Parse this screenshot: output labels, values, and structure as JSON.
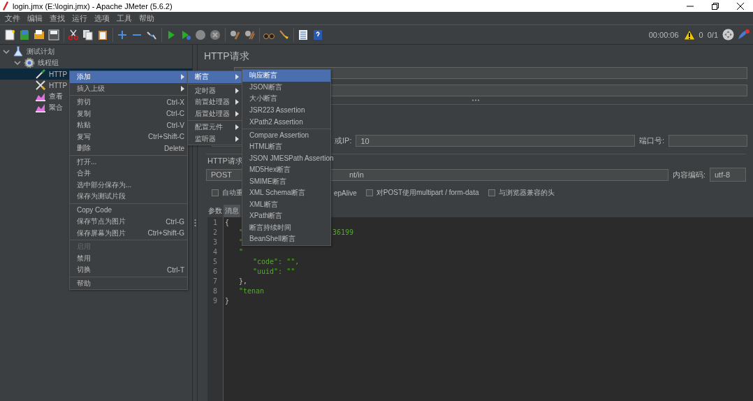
{
  "window": {
    "title": "login.jmx (E:\\login.jmx) - Apache JMeter (5.6.2)"
  },
  "menu_bar": [
    "文件",
    "编辑",
    "查找",
    "运行",
    "选项",
    "工具",
    "帮助"
  ],
  "toolbar": {
    "timer": "00:00:06",
    "warnings": "0",
    "threads": "0/1"
  },
  "tree": [
    {
      "label": "测试计划",
      "kind": "flask",
      "expanded": true,
      "selected": false,
      "children": [
        {
          "label": "线程组",
          "kind": "gear",
          "expanded": true,
          "selected": false,
          "children": [
            {
              "label": "HTTP",
              "kind": "pipette",
              "selected": true
            },
            {
              "label": "HTTP",
              "kind": "tools",
              "selected": false
            },
            {
              "label": "查看",
              "kind": "chart",
              "selected": false
            },
            {
              "label": "聚合",
              "kind": "chart",
              "selected": false
            }
          ]
        }
      ]
    }
  ],
  "panel": {
    "title": "HTTP请求",
    "server_label": "或IP:",
    "server_value": "10",
    "port_label": "端口号:",
    "group_label": "HTTP请求",
    "method": "POST",
    "path": "nt/in",
    "encoding_label": "内容编码:",
    "encoding": "utf-8",
    "options": [
      {
        "label": "自动重",
        "checked": false
      },
      {
        "label": "epAlive"
      },
      {
        "label": "对POST使用multipart / form-data",
        "checked": false
      },
      {
        "label": "与浏览器兼容的头",
        "checked": false
      }
    ],
    "tabs": [
      {
        "label": "参数",
        "selected": false
      },
      {
        "label": "消息",
        "selected": true
      }
    ],
    "code_lines": [
      {
        "number": "1",
        "text": "{"
      },
      {
        "number": "2",
        "text": "\"",
        "tail": "36199"
      },
      {
        "number": "3",
        "text": "\""
      },
      {
        "number": "4",
        "text": "\""
      },
      {
        "number": "5",
        "text": "\"code\": \"\","
      },
      {
        "number": "6",
        "text": "\"uuid\": \"\""
      },
      {
        "number": "7",
        "text": "},"
      },
      {
        "number": "8",
        "text": "\"tenan"
      },
      {
        "number": "9",
        "text": "}"
      }
    ]
  },
  "context_menu": [
    {
      "kind": "item",
      "label": "添加",
      "submenu": true,
      "selected": true,
      "disabled": false
    },
    {
      "kind": "item",
      "label": "插入上级",
      "submenu": true,
      "selected": false,
      "disabled": false
    },
    {
      "kind": "separator"
    },
    {
      "kind": "item",
      "label": "剪切",
      "shortcut": "Ctrl-X",
      "selected": false,
      "disabled": false
    },
    {
      "kind": "item",
      "label": "复制",
      "shortcut": "Ctrl-C",
      "selected": false,
      "disabled": false
    },
    {
      "kind": "item",
      "label": "粘贴",
      "shortcut": "Ctrl-V",
      "selected": false,
      "disabled": false
    },
    {
      "kind": "item",
      "label": "复写",
      "shortcut": "Ctrl+Shift-C",
      "selected": false,
      "disabled": false
    },
    {
      "kind": "item",
      "label": "删除",
      "shortcut": "Delete",
      "selected": false,
      "disabled": false
    },
    {
      "kind": "separator"
    },
    {
      "kind": "item",
      "label": "打开...",
      "selected": false,
      "disabled": false
    },
    {
      "kind": "item",
      "label": "合并",
      "selected": false,
      "disabled": false
    },
    {
      "kind": "item",
      "label": "选中部分保存为...",
      "selected": false,
      "disabled": false
    },
    {
      "kind": "item",
      "label": "保存为测试片段",
      "selected": false,
      "disabled": false
    },
    {
      "kind": "separator"
    },
    {
      "kind": "item",
      "label": "Copy Code",
      "selected": false,
      "disabled": false
    },
    {
      "kind": "item",
      "label": "保存节点为图片",
      "shortcut": "Ctrl-G",
      "selected": false,
      "disabled": false
    },
    {
      "kind": "item",
      "label": "保存屏幕为图片",
      "shortcut": "Ctrl+Shift-G",
      "selected": false,
      "disabled": false
    },
    {
      "kind": "separator"
    },
    {
      "kind": "item",
      "label": "启用",
      "selected": false,
      "disabled": true
    },
    {
      "kind": "item",
      "label": "禁用",
      "selected": false,
      "disabled": false
    },
    {
      "kind": "item",
      "label": "切换",
      "shortcut": "Ctrl-T",
      "selected": false,
      "disabled": false
    },
    {
      "kind": "separator"
    },
    {
      "kind": "item",
      "label": "帮助",
      "selected": false,
      "disabled": false
    }
  ],
  "add_submenu": [
    {
      "kind": "item",
      "label": "断言",
      "submenu": true,
      "selected": true
    },
    {
      "kind": "separator"
    },
    {
      "kind": "item",
      "label": "定时器",
      "submenu": true,
      "selected": false
    },
    {
      "kind": "item",
      "label": "前置处理器",
      "submenu": true,
      "selected": false
    },
    {
      "kind": "item",
      "label": "后置处理器",
      "submenu": true,
      "selected": false
    },
    {
      "kind": "separator"
    },
    {
      "kind": "item",
      "label": "配置元件",
      "submenu": true,
      "selected": false
    },
    {
      "kind": "item",
      "label": "监听器",
      "submenu": true,
      "selected": false
    }
  ],
  "assertion_submenu": [
    {
      "kind": "item",
      "label": "响应断言",
      "selected": true
    },
    {
      "kind": "item",
      "label": "JSON断言",
      "selected": false
    },
    {
      "kind": "item",
      "label": "大小断言",
      "selected": false
    },
    {
      "kind": "item",
      "label": "JSR223 Assertion",
      "selected": false
    },
    {
      "kind": "item",
      "label": "XPath2 Assertion",
      "selected": false
    },
    {
      "kind": "separator"
    },
    {
      "kind": "item",
      "label": "Compare Assertion",
      "selected": false
    },
    {
      "kind": "item",
      "label": "HTML断言",
      "selected": false
    },
    {
      "kind": "item",
      "label": "JSON JMESPath Assertion",
      "selected": false
    },
    {
      "kind": "item",
      "label": "MD5Hex断言",
      "selected": false
    },
    {
      "kind": "item",
      "label": "SMIME断言",
      "selected": false
    },
    {
      "kind": "item",
      "label": "XML Schema断言",
      "selected": false
    },
    {
      "kind": "item",
      "label": "XML断言",
      "selected": false
    },
    {
      "kind": "item",
      "label": "XPath断言",
      "selected": false
    },
    {
      "kind": "item",
      "label": "断言持续时间",
      "selected": false
    },
    {
      "kind": "item",
      "label": "BeanShell断言",
      "selected": false
    }
  ]
}
